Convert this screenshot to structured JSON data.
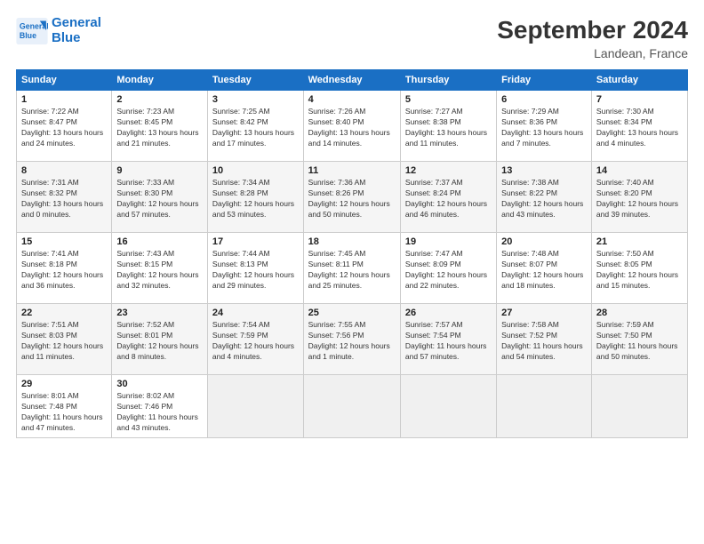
{
  "header": {
    "logo_line1": "General",
    "logo_line2": "Blue",
    "month_title": "September 2024",
    "location": "Landean, France"
  },
  "weekdays": [
    "Sunday",
    "Monday",
    "Tuesday",
    "Wednesday",
    "Thursday",
    "Friday",
    "Saturday"
  ],
  "weeks": [
    [
      {
        "day": "1",
        "sunrise": "7:22 AM",
        "sunset": "8:47 PM",
        "daylight": "13 hours and 24 minutes."
      },
      {
        "day": "2",
        "sunrise": "7:23 AM",
        "sunset": "8:45 PM",
        "daylight": "13 hours and 21 minutes."
      },
      {
        "day": "3",
        "sunrise": "7:25 AM",
        "sunset": "8:42 PM",
        "daylight": "13 hours and 17 minutes."
      },
      {
        "day": "4",
        "sunrise": "7:26 AM",
        "sunset": "8:40 PM",
        "daylight": "13 hours and 14 minutes."
      },
      {
        "day": "5",
        "sunrise": "7:27 AM",
        "sunset": "8:38 PM",
        "daylight": "13 hours and 11 minutes."
      },
      {
        "day": "6",
        "sunrise": "7:29 AM",
        "sunset": "8:36 PM",
        "daylight": "13 hours and 7 minutes."
      },
      {
        "day": "7",
        "sunrise": "7:30 AM",
        "sunset": "8:34 PM",
        "daylight": "13 hours and 4 minutes."
      }
    ],
    [
      {
        "day": "8",
        "sunrise": "7:31 AM",
        "sunset": "8:32 PM",
        "daylight": "13 hours and 0 minutes."
      },
      {
        "day": "9",
        "sunrise": "7:33 AM",
        "sunset": "8:30 PM",
        "daylight": "12 hours and 57 minutes."
      },
      {
        "day": "10",
        "sunrise": "7:34 AM",
        "sunset": "8:28 PM",
        "daylight": "12 hours and 53 minutes."
      },
      {
        "day": "11",
        "sunrise": "7:36 AM",
        "sunset": "8:26 PM",
        "daylight": "12 hours and 50 minutes."
      },
      {
        "day": "12",
        "sunrise": "7:37 AM",
        "sunset": "8:24 PM",
        "daylight": "12 hours and 46 minutes."
      },
      {
        "day": "13",
        "sunrise": "7:38 AM",
        "sunset": "8:22 PM",
        "daylight": "12 hours and 43 minutes."
      },
      {
        "day": "14",
        "sunrise": "7:40 AM",
        "sunset": "8:20 PM",
        "daylight": "12 hours and 39 minutes."
      }
    ],
    [
      {
        "day": "15",
        "sunrise": "7:41 AM",
        "sunset": "8:18 PM",
        "daylight": "12 hours and 36 minutes."
      },
      {
        "day": "16",
        "sunrise": "7:43 AM",
        "sunset": "8:15 PM",
        "daylight": "12 hours and 32 minutes."
      },
      {
        "day": "17",
        "sunrise": "7:44 AM",
        "sunset": "8:13 PM",
        "daylight": "12 hours and 29 minutes."
      },
      {
        "day": "18",
        "sunrise": "7:45 AM",
        "sunset": "8:11 PM",
        "daylight": "12 hours and 25 minutes."
      },
      {
        "day": "19",
        "sunrise": "7:47 AM",
        "sunset": "8:09 PM",
        "daylight": "12 hours and 22 minutes."
      },
      {
        "day": "20",
        "sunrise": "7:48 AM",
        "sunset": "8:07 PM",
        "daylight": "12 hours and 18 minutes."
      },
      {
        "day": "21",
        "sunrise": "7:50 AM",
        "sunset": "8:05 PM",
        "daylight": "12 hours and 15 minutes."
      }
    ],
    [
      {
        "day": "22",
        "sunrise": "7:51 AM",
        "sunset": "8:03 PM",
        "daylight": "12 hours and 11 minutes."
      },
      {
        "day": "23",
        "sunrise": "7:52 AM",
        "sunset": "8:01 PM",
        "daylight": "12 hours and 8 minutes."
      },
      {
        "day": "24",
        "sunrise": "7:54 AM",
        "sunset": "7:59 PM",
        "daylight": "12 hours and 4 minutes."
      },
      {
        "day": "25",
        "sunrise": "7:55 AM",
        "sunset": "7:56 PM",
        "daylight": "12 hours and 1 minute."
      },
      {
        "day": "26",
        "sunrise": "7:57 AM",
        "sunset": "7:54 PM",
        "daylight": "11 hours and 57 minutes."
      },
      {
        "day": "27",
        "sunrise": "7:58 AM",
        "sunset": "7:52 PM",
        "daylight": "11 hours and 54 minutes."
      },
      {
        "day": "28",
        "sunrise": "7:59 AM",
        "sunset": "7:50 PM",
        "daylight": "11 hours and 50 minutes."
      }
    ],
    [
      {
        "day": "29",
        "sunrise": "8:01 AM",
        "sunset": "7:48 PM",
        "daylight": "11 hours and 47 minutes."
      },
      {
        "day": "30",
        "sunrise": "8:02 AM",
        "sunset": "7:46 PM",
        "daylight": "11 hours and 43 minutes."
      },
      null,
      null,
      null,
      null,
      null
    ]
  ]
}
